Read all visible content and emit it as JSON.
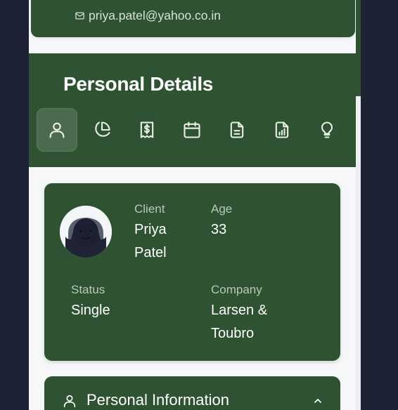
{
  "contact": {
    "email": "priya.patel@yahoo.co.in"
  },
  "header": {
    "title": "Personal Details",
    "tabs": [
      {
        "icon": "user-icon",
        "active": true
      },
      {
        "icon": "pie-chart-icon",
        "active": false
      },
      {
        "icon": "receipt-icon",
        "active": false
      },
      {
        "icon": "calendar-icon",
        "active": false
      },
      {
        "icon": "document-icon",
        "active": false
      },
      {
        "icon": "report-icon",
        "active": false
      },
      {
        "icon": "lightbulb-icon",
        "active": false
      }
    ]
  },
  "profile": {
    "client_label": "Client",
    "client_first": "Priya",
    "client_last": "Patel",
    "age_label": "Age",
    "age_value": "33",
    "status_label": "Status",
    "status_value": "Single",
    "company_label": "Company",
    "company_line1": "Larsen &",
    "company_line2": "Toubro"
  },
  "section": {
    "title": "Personal Information",
    "expanded": true
  },
  "colors": {
    "accent": "#2f5232",
    "active_tab": "#4c6b4e",
    "background": "#1e2235",
    "surface": "#f6f7f9"
  }
}
